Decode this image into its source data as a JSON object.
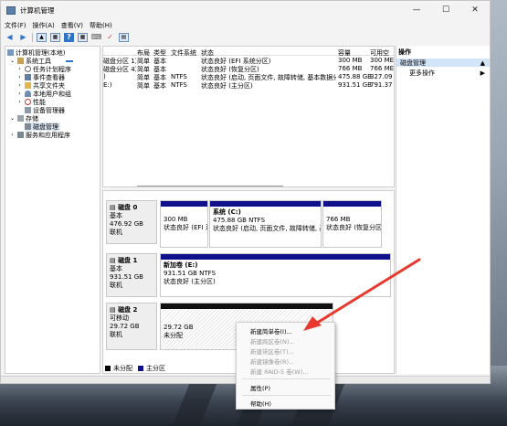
{
  "window": {
    "title": "计算机管理",
    "controls": {
      "minimize": "—",
      "maximize": "☐",
      "close": "✕"
    }
  },
  "menu": [
    "文件(F)",
    "操作(A)",
    "查看(V)",
    "帮助(H)"
  ],
  "tree": {
    "root": "计算机管理(本地)",
    "system_tools": "系统工具",
    "task_scheduler": "任务计划程序",
    "event_viewer": "事件查看器",
    "shared_folders": "共享文件夹",
    "local_users": "本地用户和组",
    "performance": "性能",
    "device_manager": "设备管理器",
    "storage": "存储",
    "disk_management": "磁盘管理",
    "services_apps": "服务和应用程序"
  },
  "volume_table": {
    "headers": [
      "布局",
      "类型",
      "文件系统",
      "状态",
      "容量",
      "可用空"
    ],
    "rows": [
      {
        "name": "磁盘分区 1)",
        "layout": "简单",
        "type": "基本",
        "fs": "",
        "status": "状态良好 (EFI 系统分区)",
        "cap": "300 MB",
        "free": "300 ME"
      },
      {
        "name": "磁盘分区 4)",
        "layout": "简单",
        "type": "基本",
        "fs": "",
        "status": "状态良好 (恢复分区)",
        "cap": "766 MB",
        "free": "766 ME"
      },
      {
        "name": ")",
        "layout": "简单",
        "type": "基本",
        "fs": "NTFS",
        "status": "状态良好 (启动, 页面文件, 故障转储, 基本数据分区)",
        "cap": "475.88 GB",
        "free": "327.09"
      },
      {
        "name": "E:)",
        "layout": "简单",
        "type": "基本",
        "fs": "NTFS",
        "status": "状态良好 (主分区)",
        "cap": "931.51 GB",
        "free": "791.37"
      }
    ]
  },
  "disks": [
    {
      "name": "磁盘 0",
      "type": "基本",
      "size": "476.92 GB",
      "state": "联机",
      "parts": [
        {
          "title": "",
          "line1": "300 MB",
          "line2": "状态良好 (EFI 系"
        },
        {
          "title": "系统 (C:)",
          "line1": "475.88 GB NTFS",
          "line2": "状态良好 (启动, 页面文件, 故障转储, 基本"
        },
        {
          "title": "",
          "line1": "766 MB",
          "line2": "状态良好 (恢复分区"
        }
      ]
    },
    {
      "name": "磁盘 1",
      "type": "基本",
      "size": "931.51 GB",
      "state": "联机",
      "parts": [
        {
          "title": "新加卷 (E:)",
          "line1": "931.51 GB NTFS",
          "line2": "状态良好 (主分区)"
        }
      ]
    },
    {
      "name": "磁盘 2",
      "type": "可移动",
      "size": "29.72 GB",
      "state": "联机",
      "parts": [
        {
          "title": "",
          "line1": "29.72 GB",
          "line2": "未分配"
        }
      ]
    }
  ],
  "legend": {
    "unallocated": "未分配",
    "primary": "主分区",
    "unallocated_color": "#000000",
    "primary_color": "#10108a"
  },
  "actions": {
    "header": "操作",
    "section": "磁盘管理",
    "more": "更多操作"
  },
  "context_menu": [
    {
      "label": "新建简单卷(I)...",
      "enabled": true
    },
    {
      "label": "新建跨区卷(N)...",
      "enabled": false
    },
    {
      "label": "新建带区卷(T)...",
      "enabled": false
    },
    {
      "label": "新建镜像卷(R)...",
      "enabled": false
    },
    {
      "label": "新建 RAID-5 卷(W)...",
      "enabled": false
    },
    {
      "label": "属性(P)",
      "enabled": true
    },
    {
      "label": "帮助(H)",
      "enabled": true
    }
  ],
  "colors": {
    "accent": "#2e74c9",
    "annotation_arrow": "#e8392e",
    "primary_partition": "#10108a"
  }
}
